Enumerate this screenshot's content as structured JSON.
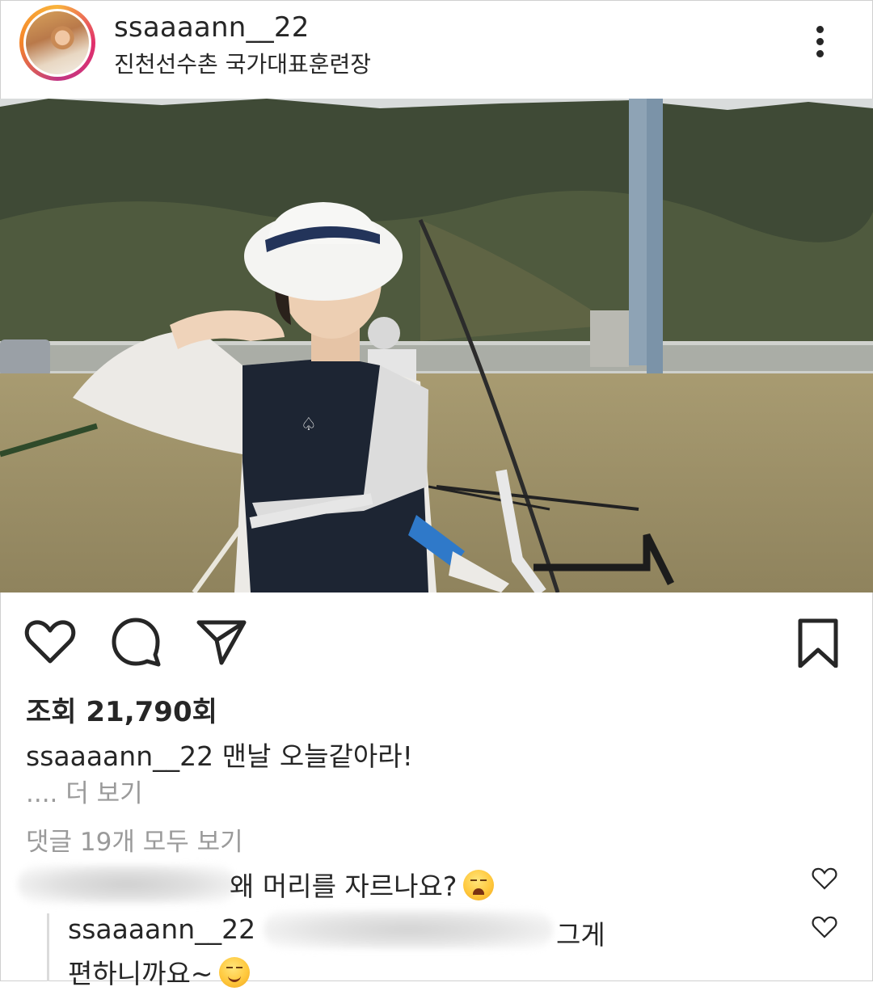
{
  "post": {
    "username": "ssaaaann__22",
    "location": "진천선수촌 국가대표훈련장",
    "views": "조회 21,790회",
    "caption_user": "ssaaaann__22",
    "caption_text": "맨날 오늘같아라!",
    "more_label": ".... 더 보기",
    "view_all_comments": "댓글 19개 모두 보기"
  },
  "comments": [
    {
      "user": "",
      "text": "왜 머리를 자르나요?",
      "emoji": "weary-face"
    },
    {
      "user": "ssaaaann__22",
      "text": "그게",
      "text_cont": "편하니까요~",
      "emoji": "smirking-face",
      "is_reply": true
    }
  ],
  "icons": {
    "more": "more-vertical-icon",
    "like": "heart-icon",
    "comment": "comment-bubble-icon",
    "share": "paper-plane-icon",
    "save": "bookmark-icon"
  }
}
